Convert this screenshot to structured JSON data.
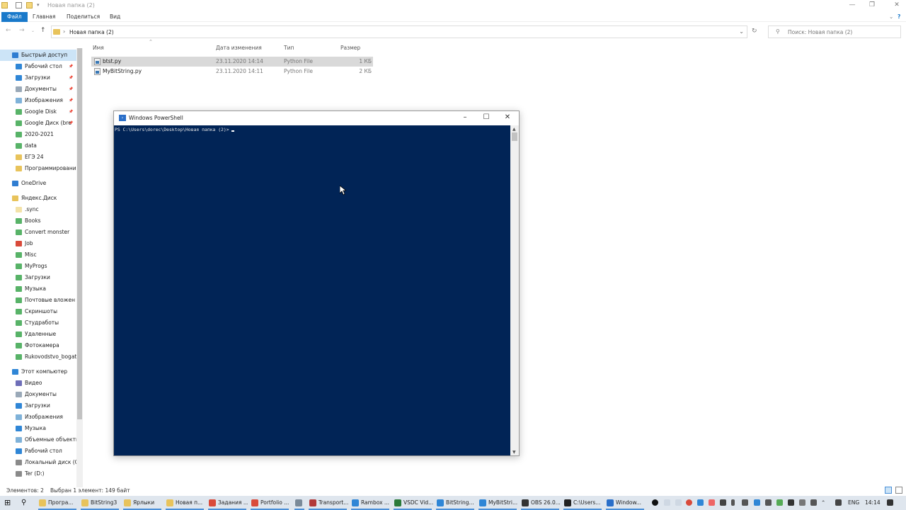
{
  "window": {
    "title": "Новая папка (2)"
  },
  "ribbon": {
    "tabs": [
      "Файл",
      "Главная",
      "Поделиться",
      "Вид"
    ]
  },
  "nav": {
    "path": "Новая папка (2)",
    "search_placeholder": "Поиск: Новая папка (2)"
  },
  "sidebar": {
    "items": [
      {
        "label": "Быстрый доступ",
        "icon": "star-icon",
        "color": "#2f7dd1",
        "pinned": false,
        "level": 0
      },
      {
        "label": "Рабочий стол",
        "icon": "desktop-icon",
        "color": "#2f86d6",
        "pinned": true,
        "level": 1
      },
      {
        "label": "Загрузки",
        "icon": "download-icon",
        "color": "#2f86d6",
        "pinned": true,
        "level": 1
      },
      {
        "label": "Документы",
        "icon": "documents-icon",
        "color": "#9aa9b8",
        "pinned": true,
        "level": 1
      },
      {
        "label": "Изображения",
        "icon": "pictures-icon",
        "color": "#7fb2d9",
        "pinned": true,
        "level": 1
      },
      {
        "label": "Google Disk",
        "icon": "gdrive-folder-icon",
        "color": "#58b368",
        "pinned": true,
        "level": 1
      },
      {
        "label": "Google Диск (bre",
        "icon": "gdrive-folder-icon",
        "color": "#58b368",
        "pinned": true,
        "level": 1
      },
      {
        "label": "2020-2021",
        "icon": "gdrive-folder-icon",
        "color": "#58b368",
        "pinned": false,
        "level": 1
      },
      {
        "label": "data",
        "icon": "gdrive-folder-icon",
        "color": "#58b368",
        "pinned": false,
        "level": 1
      },
      {
        "label": "ЕГЭ 24",
        "icon": "folder-icon",
        "color": "#e8c35b",
        "pinned": false,
        "level": 1
      },
      {
        "label": "Программировани",
        "icon": "folder-icon",
        "color": "#e8c35b",
        "pinned": false,
        "level": 1
      },
      {
        "label": "OneDrive",
        "icon": "cloud-icon",
        "color": "#2f7dd1",
        "pinned": false,
        "level": 0
      },
      {
        "label": "Яндекс.Диск",
        "icon": "yadisk-icon",
        "color": "#e8c35b",
        "pinned": false,
        "level": 0
      },
      {
        "label": ".sync",
        "icon": "folder-icon",
        "color": "#f3e2a8",
        "pinned": false,
        "level": 1
      },
      {
        "label": "Books",
        "icon": "yadisk-folder-icon",
        "color": "#58b368",
        "pinned": false,
        "level": 1
      },
      {
        "label": "Convert monster",
        "icon": "yadisk-folder-icon",
        "color": "#58b368",
        "pinned": false,
        "level": 1
      },
      {
        "label": "Job",
        "icon": "yadisk-folder-icon",
        "color": "#d94a3a",
        "pinned": false,
        "level": 1
      },
      {
        "label": "Misc",
        "icon": "yadisk-folder-icon",
        "color": "#58b368",
        "pinned": false,
        "level": 1
      },
      {
        "label": "MyProgs",
        "icon": "yadisk-folder-icon",
        "color": "#58b368",
        "pinned": false,
        "level": 1
      },
      {
        "label": "Загрузки",
        "icon": "yadisk-folder-icon",
        "color": "#58b368",
        "pinned": false,
        "level": 1
      },
      {
        "label": "Музыка",
        "icon": "yadisk-folder-icon",
        "color": "#58b368",
        "pinned": false,
        "level": 1
      },
      {
        "label": "Почтовые вложен",
        "icon": "yadisk-folder-icon",
        "color": "#58b368",
        "pinned": false,
        "level": 1
      },
      {
        "label": "Скриншоты",
        "icon": "yadisk-folder-icon",
        "color": "#58b368",
        "pinned": false,
        "level": 1
      },
      {
        "label": "Студработы",
        "icon": "yadisk-folder-icon",
        "color": "#58b368",
        "pinned": false,
        "level": 1
      },
      {
        "label": "Удаленные",
        "icon": "yadisk-folder-icon",
        "color": "#58b368",
        "pinned": false,
        "level": 1
      },
      {
        "label": "Фотокамера",
        "icon": "yadisk-folder-icon",
        "color": "#58b368",
        "pinned": false,
        "level": 1
      },
      {
        "label": "Rukovodstvo_bogat",
        "icon": "yadisk-folder-icon",
        "color": "#58b368",
        "pinned": false,
        "level": 1
      },
      {
        "label": "Этот компьютер",
        "icon": "computer-icon",
        "color": "#2f86d6",
        "pinned": false,
        "level": 0
      },
      {
        "label": "Видео",
        "icon": "video-icon",
        "color": "#6e6eb8",
        "pinned": false,
        "level": 1
      },
      {
        "label": "Документы",
        "icon": "documents-icon",
        "color": "#9aa9b8",
        "pinned": false,
        "level": 1
      },
      {
        "label": "Загрузки",
        "icon": "download-icon",
        "color": "#2f86d6",
        "pinned": false,
        "level": 1
      },
      {
        "label": "Изображения",
        "icon": "pictures-icon",
        "color": "#7fb2d9",
        "pinned": false,
        "level": 1
      },
      {
        "label": "Музыка",
        "icon": "music-icon",
        "color": "#2f86d6",
        "pinned": false,
        "level": 1
      },
      {
        "label": "Объемные объекты",
        "icon": "3d-objects-icon",
        "color": "#7fb2d9",
        "pinned": false,
        "level": 1
      },
      {
        "label": "Рабочий стол",
        "icon": "desktop-icon",
        "color": "#2f86d6",
        "pinned": false,
        "level": 1
      },
      {
        "label": "Локальный диск (C",
        "icon": "drive-icon",
        "color": "#8a8a8a",
        "pinned": false,
        "level": 1
      },
      {
        "label": "Ter (D:)",
        "icon": "drive-icon",
        "color": "#8a8a8a",
        "pinned": false,
        "level": 1
      }
    ]
  },
  "files": {
    "columns": [
      "Имя",
      "Дата изменения",
      "Тип",
      "Размер"
    ],
    "rows": [
      {
        "name": "btst.py",
        "date": "23.11.2020 14:14",
        "type": "Python File",
        "size": "1 КБ",
        "selected": true
      },
      {
        "name": "MyBitString.py",
        "date": "23.11.2020 14:11",
        "type": "Python File",
        "size": "2 КБ",
        "selected": false
      }
    ]
  },
  "powershell": {
    "title": "Windows PowerShell",
    "prompt": "PS C:\\Users\\dorec\\Desktop\\Новая папка (2)>",
    "background": "#012456"
  },
  "status": {
    "count": "Элементов: 2",
    "selection": "Выбран 1 элемент: 149 байт"
  },
  "taskbar": {
    "items": [
      {
        "label": "Програ...",
        "icon": "folder-icon",
        "color": "#e8c35b"
      },
      {
        "label": "BitString3",
        "icon": "folder-icon",
        "color": "#e8c35b"
      },
      {
        "label": "Ярлыки",
        "icon": "folder-icon",
        "color": "#e8c35b"
      },
      {
        "label": "Новая п...",
        "icon": "folder-icon",
        "color": "#e8c35b"
      },
      {
        "label": "Задания ...",
        "icon": "chrome-icon",
        "color": "#d94a3a"
      },
      {
        "label": "Portfolio ...",
        "icon": "chrome-icon",
        "color": "#d94a3a"
      },
      {
        "label": "",
        "icon": "notepad-icon",
        "color": "#7a8a99"
      },
      {
        "label": "Transport...",
        "icon": "app-icon",
        "color": "#b23a3a"
      },
      {
        "label": "Rambox ...",
        "icon": "rambox-icon",
        "color": "#2f86d6"
      },
      {
        "label": "VSDC Vid...",
        "icon": "vsdc-icon",
        "color": "#2a7a3a"
      },
      {
        "label": "BitString...",
        "icon": "pycharm-icon",
        "color": "#2f86d6"
      },
      {
        "label": "MyBitStri...",
        "icon": "pycharm-icon",
        "color": "#2f86d6"
      },
      {
        "label": "OBS 26.0...",
        "icon": "obs-icon",
        "color": "#333333"
      },
      {
        "label": "C:\\Users...",
        "icon": "cmd-icon",
        "color": "#222222"
      },
      {
        "label": "Window...",
        "icon": "powershell-icon",
        "color": "#2a6fc9"
      }
    ],
    "lang": "ENG",
    "time": "14:14"
  }
}
